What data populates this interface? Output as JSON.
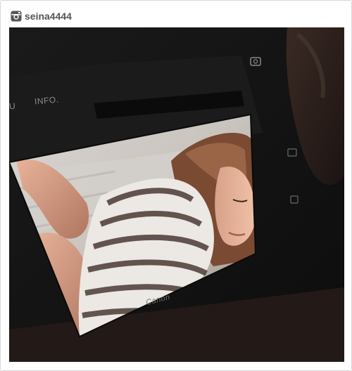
{
  "header": {
    "icon": "instagram-icon",
    "username": "seina4444"
  },
  "photo": {
    "camera_labels": {
      "menu_fragment": "U",
      "info": "INFO.",
      "brand": "Canon"
    }
  }
}
